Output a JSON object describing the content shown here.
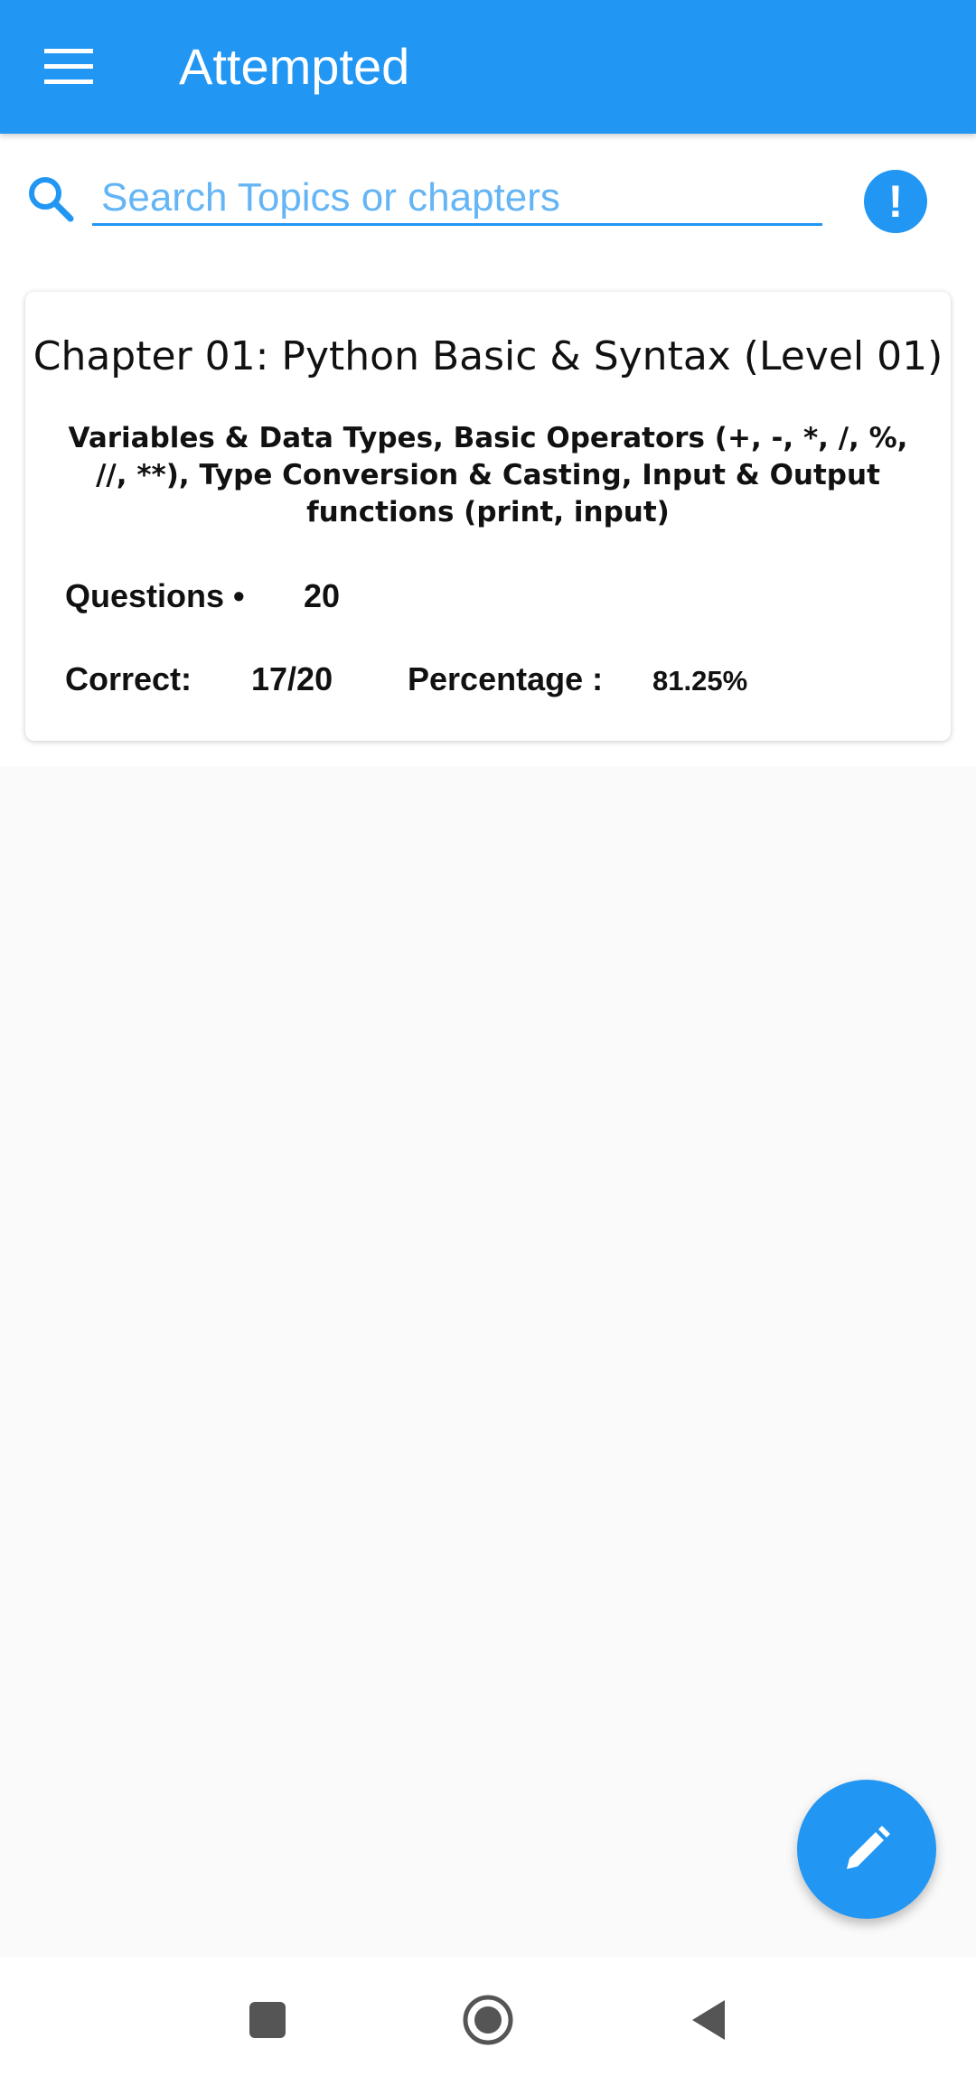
{
  "app_bar": {
    "title": "Attempted",
    "menu_icon": "menu-icon"
  },
  "search": {
    "placeholder": "Search Topics or chapters",
    "value": "",
    "icon": "search-icon",
    "info_icon": "exclamation-icon"
  },
  "chapters": [
    {
      "title": "Chapter 01: Python Basic & Syntax (Level 01)",
      "description": "Variables & Data Types, Basic Operators (+, -, *, /, %, //, **), Type Conversion & Casting, Input & Output functions (print, input)",
      "questions_label": "Questions •",
      "questions_count": "20",
      "correct_label": "Correct:",
      "correct_value": "17/20",
      "percentage_label": "Percentage :",
      "percentage_value": "81.25%"
    }
  ],
  "fab": {
    "icon": "pencil-icon"
  },
  "nav": {
    "recents_icon": "square-icon",
    "home_icon": "circle-icon",
    "back_icon": "triangle-back-icon"
  },
  "colors": {
    "primary": "#2196f3",
    "placeholder": "#64b5f6",
    "background": "#fafafa"
  }
}
